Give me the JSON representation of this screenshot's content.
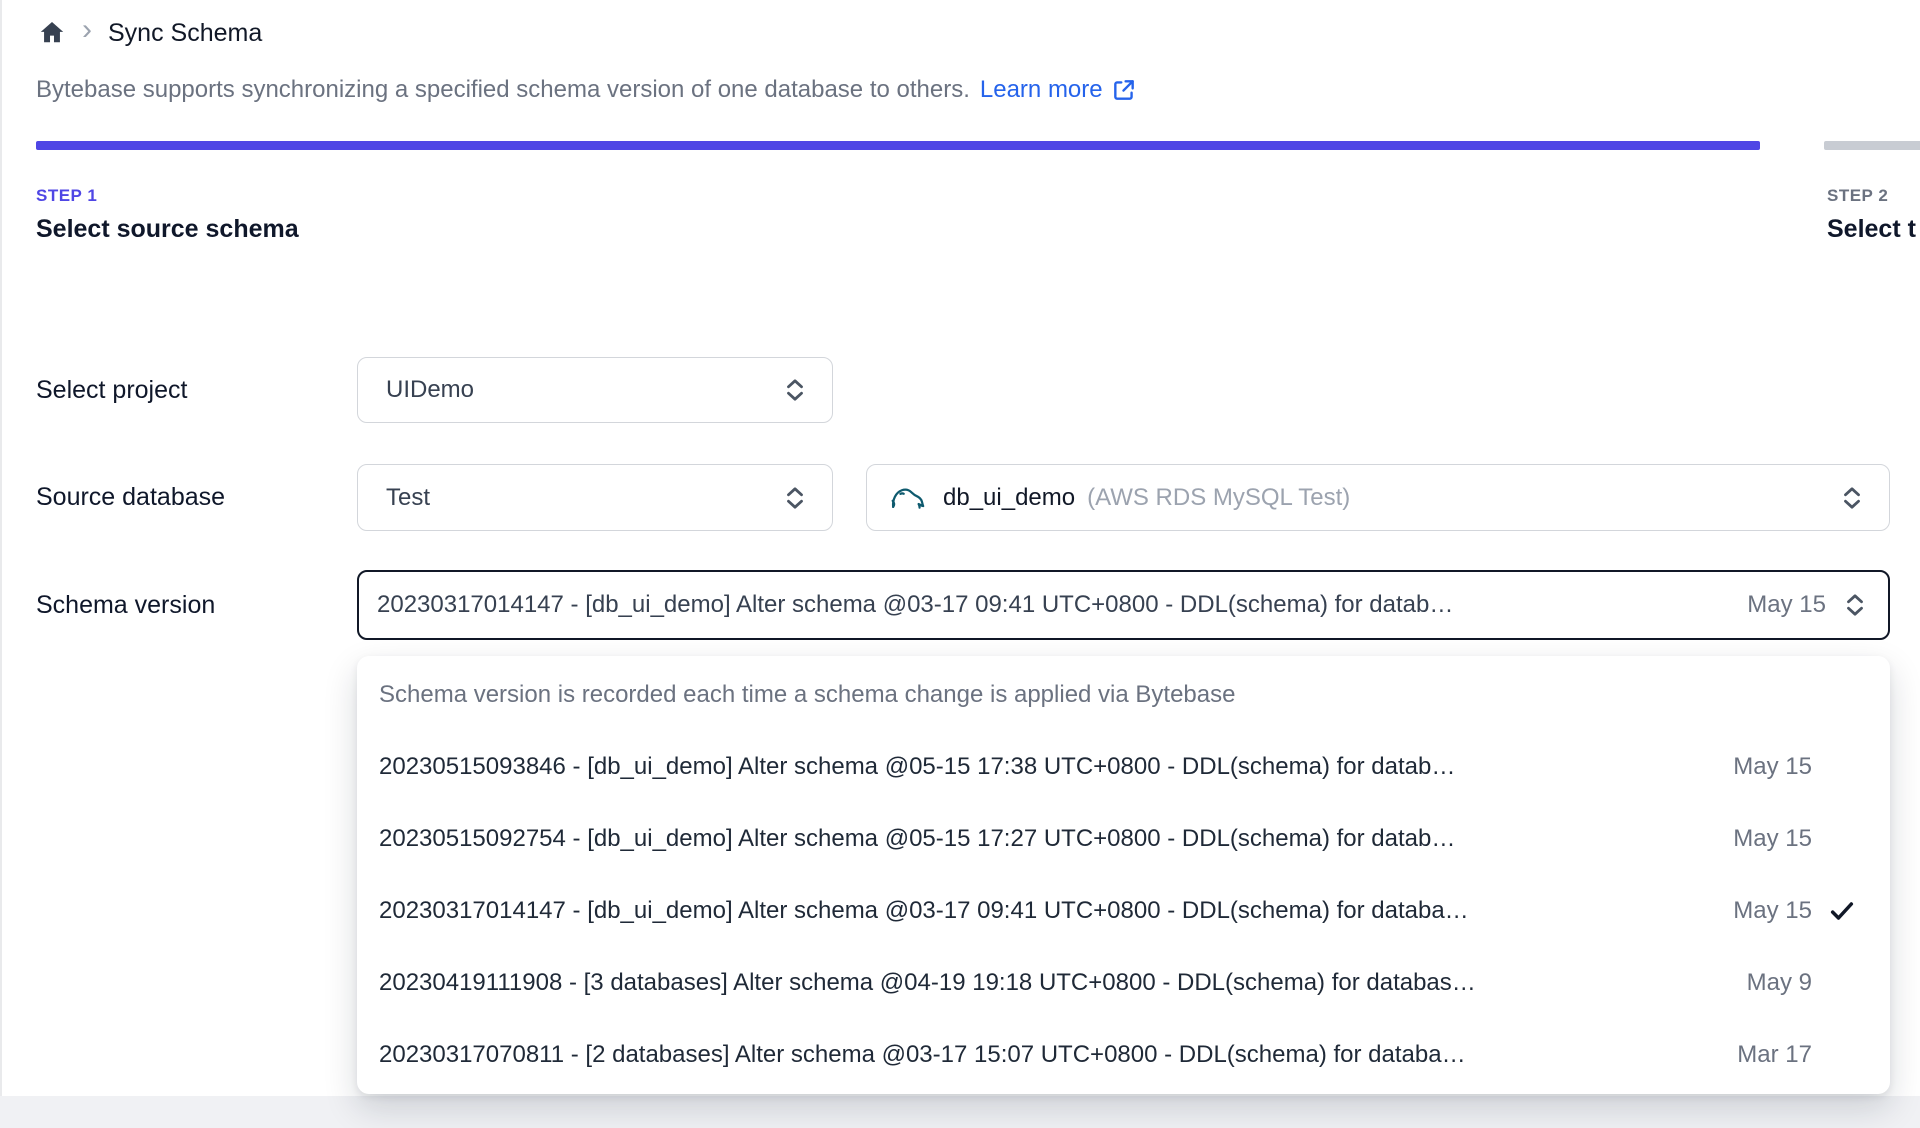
{
  "colors": {
    "accent": "#4f46e5",
    "link": "#2563eb",
    "bar_inactive": "#c8ccd3",
    "muted_text": "#6b7280"
  },
  "icons": {
    "home": "house-filled",
    "breadcrumb_separator": "›",
    "external_link": "arrow-out-of-box",
    "select_toggle": "chevrons-up-down",
    "mysql": "dolphin",
    "selected": "checkmark"
  },
  "breadcrumb": {
    "title": "Sync Schema"
  },
  "intro": {
    "text": "Bytebase supports synchronizing a specified schema version of one database to others.",
    "link_label": "Learn more"
  },
  "steps": [
    {
      "label": "STEP 1",
      "title": "Select source schema"
    },
    {
      "label": "STEP 2",
      "title": "Select t"
    }
  ],
  "form": {
    "project": {
      "label": "Select project",
      "value": "UIDemo"
    },
    "source_database": {
      "label": "Source database",
      "environment": "Test",
      "database": "db_ui_demo",
      "instance": "(AWS RDS MySQL Test)"
    },
    "schema_version": {
      "label": "Schema version",
      "value": "20230317014147 - [db_ui_demo] Alter schema @03-17 09:41 UTC+0800 - DDL(schema) for datab…",
      "date": "May 15"
    }
  },
  "dropdown": {
    "note": "Schema version is recorded each time a schema change is applied via Bytebase",
    "options": [
      {
        "text": "20230515093846 - [db_ui_demo] Alter schema @05-15 17:38 UTC+0800 - DDL(schema) for datab…",
        "date": "May 15",
        "selected": false
      },
      {
        "text": "20230515092754 - [db_ui_demo] Alter schema @05-15 17:27 UTC+0800 - DDL(schema) for datab…",
        "date": "May 15",
        "selected": false
      },
      {
        "text": "20230317014147 - [db_ui_demo] Alter schema @03-17 09:41 UTC+0800 - DDL(schema) for databa…",
        "date": "May 15",
        "selected": true
      },
      {
        "text": "20230419111908 - [3 databases] Alter schema @04-19 19:18 UTC+0800 - DDL(schema) for databas…",
        "date": "May 9",
        "selected": false
      },
      {
        "text": "20230317070811 - [2 databases] Alter schema @03-17 15:07 UTC+0800 - DDL(schema) for databa…",
        "date": "Mar 17",
        "selected": false
      }
    ]
  }
}
